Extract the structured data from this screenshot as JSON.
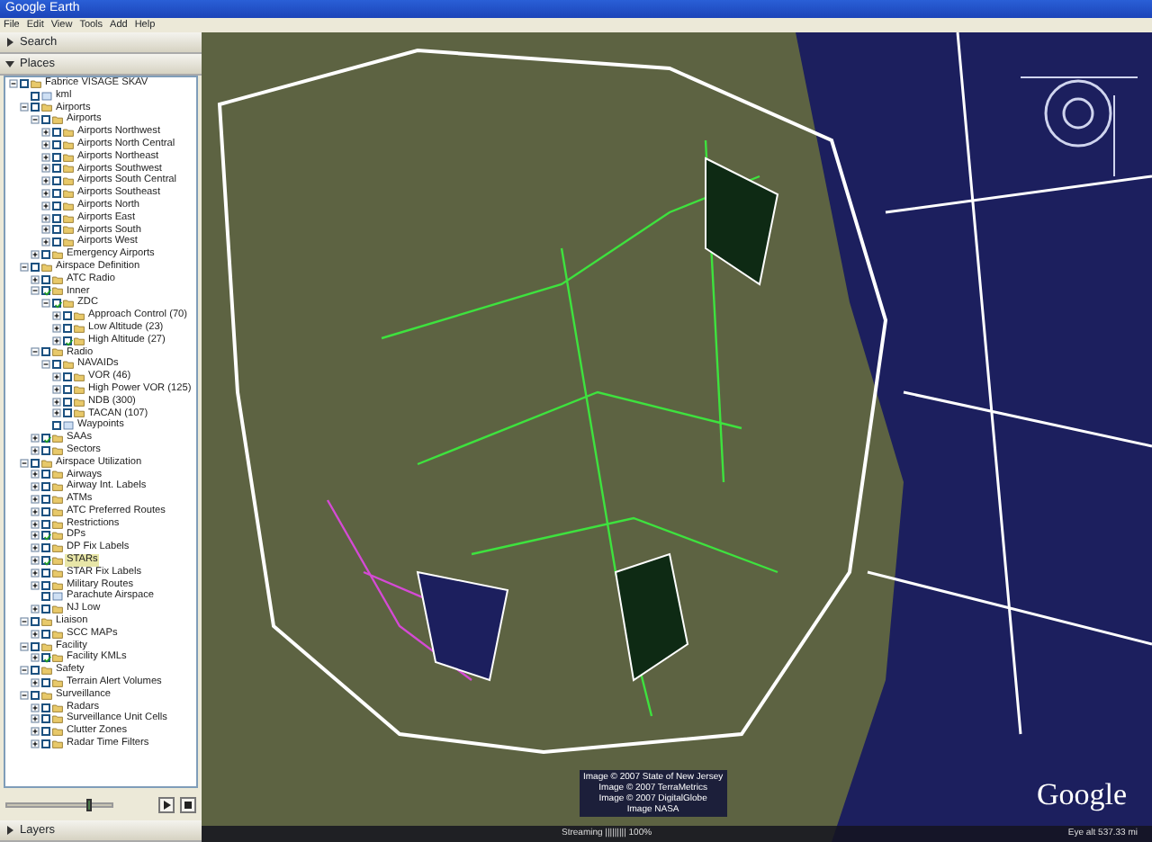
{
  "window": {
    "title": "Google Earth"
  },
  "menu": [
    "File",
    "Edit",
    "View",
    "Tools",
    "Add",
    "Help"
  ],
  "panels": [
    {
      "label": "Search",
      "expanded": false
    },
    {
      "label": "Places",
      "expanded": true
    }
  ],
  "places": [
    {
      "label": "Fabrice VISAGE SKAV",
      "kind": "folder",
      "expanded": true,
      "checked": false,
      "selected": false,
      "children": [
        {
          "label": "kml",
          "kind": "layer",
          "checked": false,
          "selected": false
        },
        {
          "label": "Airports",
          "kind": "folder",
          "expanded": true,
          "checked": false,
          "selected": false,
          "children": [
            {
              "label": "Airports",
              "kind": "folder",
              "expanded": true,
              "checked": false,
              "selected": false,
              "children": [
                {
                  "label": "Airports Northwest",
                  "kind": "folder",
                  "expanded": false,
                  "checked": false,
                  "selected": false
                },
                {
                  "label": "Airports North Central",
                  "kind": "folder",
                  "expanded": false,
                  "checked": false,
                  "selected": false
                },
                {
                  "label": "Airports Northeast",
                  "kind": "folder",
                  "expanded": false,
                  "checked": false,
                  "selected": false
                },
                {
                  "label": "Airports Southwest",
                  "kind": "folder",
                  "expanded": false,
                  "checked": false,
                  "selected": false
                },
                {
                  "label": "Airports South Central",
                  "kind": "folder",
                  "expanded": false,
                  "checked": false,
                  "selected": false
                },
                {
                  "label": "Airports Southeast",
                  "kind": "folder",
                  "expanded": false,
                  "checked": false,
                  "selected": false
                },
                {
                  "label": "Airports North",
                  "kind": "folder",
                  "expanded": false,
                  "checked": false,
                  "selected": false
                },
                {
                  "label": "Airports East",
                  "kind": "folder",
                  "expanded": false,
                  "checked": false,
                  "selected": false
                },
                {
                  "label": "Airports South",
                  "kind": "folder",
                  "expanded": false,
                  "checked": false,
                  "selected": false
                },
                {
                  "label": "Airports West",
                  "kind": "folder",
                  "expanded": false,
                  "checked": false,
                  "selected": false
                }
              ]
            },
            {
              "label": "Emergency Airports",
              "kind": "folder",
              "expanded": false,
              "checked": false,
              "selected": false
            }
          ]
        },
        {
          "label": "Airspace Definition",
          "kind": "folder",
          "expanded": true,
          "checked": false,
          "selected": false,
          "children": [
            {
              "label": "ATC Radio",
              "kind": "folder",
              "expanded": false,
              "checked": false,
              "selected": false
            },
            {
              "label": "Inner",
              "kind": "folder",
              "expanded": true,
              "checked": true,
              "selected": false,
              "children": [
                {
                  "label": "ZDC",
                  "kind": "folder",
                  "expanded": true,
                  "checked": true,
                  "selected": false,
                  "children": [
                    {
                      "label": "Approach Control (70)",
                      "kind": "folder",
                      "expanded": false,
                      "checked": false,
                      "selected": false
                    },
                    {
                      "label": "Low Altitude (23)",
                      "kind": "folder",
                      "expanded": false,
                      "checked": false,
                      "selected": false
                    },
                    {
                      "label": "High Altitude (27)",
                      "kind": "folder",
                      "expanded": false,
                      "checked": true,
                      "selected": false
                    }
                  ]
                }
              ]
            },
            {
              "label": "Radio",
              "kind": "folder",
              "expanded": true,
              "checked": false,
              "selected": false,
              "children": [
                {
                  "label": "NAVAIDs",
                  "kind": "folder",
                  "expanded": true,
                  "checked": false,
                  "selected": false,
                  "children": [
                    {
                      "label": "VOR (46)",
                      "kind": "folder",
                      "expanded": false,
                      "checked": false,
                      "selected": false
                    },
                    {
                      "label": "High Power VOR (125)",
                      "kind": "folder",
                      "expanded": false,
                      "checked": false,
                      "selected": false
                    },
                    {
                      "label": "NDB (300)",
                      "kind": "folder",
                      "expanded": false,
                      "checked": false,
                      "selected": false
                    },
                    {
                      "label": "TACAN (107)",
                      "kind": "folder",
                      "expanded": false,
                      "checked": false,
                      "selected": false
                    }
                  ]
                },
                {
                  "label": "Waypoints",
                  "kind": "layer",
                  "checked": false,
                  "selected": false
                }
              ]
            },
            {
              "label": "SAAs",
              "kind": "folder",
              "expanded": false,
              "checked": true,
              "selected": false
            },
            {
              "label": "Sectors",
              "kind": "folder",
              "expanded": false,
              "checked": false,
              "selected": false
            }
          ]
        },
        {
          "label": "Airspace Utilization",
          "kind": "folder",
          "expanded": true,
          "checked": false,
          "selected": false,
          "children": [
            {
              "label": "Airways",
              "kind": "folder",
              "expanded": false,
              "checked": false,
              "selected": false
            },
            {
              "label": "Airway Int. Labels",
              "kind": "folder",
              "expanded": false,
              "checked": false,
              "selected": false
            },
            {
              "label": "ATMs",
              "kind": "folder",
              "expanded": false,
              "checked": false,
              "selected": false
            },
            {
              "label": "ATC Preferred Routes",
              "kind": "folder",
              "expanded": false,
              "checked": false,
              "selected": false
            },
            {
              "label": "Restrictions",
              "kind": "folder",
              "expanded": false,
              "checked": false,
              "selected": false
            },
            {
              "label": "DPs",
              "kind": "folder",
              "expanded": false,
              "checked": true,
              "selected": false
            },
            {
              "label": "DP Fix Labels",
              "kind": "folder",
              "expanded": false,
              "checked": false,
              "selected": false
            },
            {
              "label": "STARs",
              "kind": "folder",
              "expanded": false,
              "checked": true,
              "selected": true
            },
            {
              "label": "STAR Fix Labels",
              "kind": "folder",
              "expanded": false,
              "checked": false,
              "selected": false
            },
            {
              "label": "Military Routes",
              "kind": "folder",
              "expanded": false,
              "checked": false,
              "selected": false
            },
            {
              "label": "Parachute Airspace",
              "kind": "layer",
              "checked": false,
              "selected": false
            },
            {
              "label": "NJ Low",
              "kind": "folder",
              "expanded": false,
              "checked": false,
              "selected": false
            }
          ]
        },
        {
          "label": "Liaison",
          "kind": "folder",
          "expanded": true,
          "checked": false,
          "selected": false,
          "children": [
            {
              "label": "SCC MAPs",
              "kind": "folder",
              "expanded": false,
              "checked": false,
              "selected": false
            }
          ]
        },
        {
          "label": "Facility",
          "kind": "folder",
          "expanded": true,
          "checked": false,
          "selected": false,
          "children": [
            {
              "label": "Facility KMLs",
              "kind": "folder",
              "expanded": false,
              "checked": true,
              "selected": false
            }
          ]
        },
        {
          "label": "Safety",
          "kind": "folder",
          "expanded": true,
          "checked": false,
          "selected": false,
          "children": [
            {
              "label": "Terrain Alert Volumes",
              "kind": "folder",
              "expanded": false,
              "checked": false,
              "selected": false
            }
          ]
        },
        {
          "label": "Surveillance",
          "kind": "folder",
          "expanded": true,
          "checked": false,
          "selected": false,
          "children": [
            {
              "label": "Radars",
              "kind": "folder",
              "expanded": false,
              "checked": false,
              "selected": false
            },
            {
              "label": "Surveillance Unit Cells",
              "kind": "folder",
              "expanded": false,
              "checked": false,
              "selected": false
            },
            {
              "label": "Clutter Zones",
              "kind": "folder",
              "expanded": false,
              "checked": false,
              "selected": false
            },
            {
              "label": "Radar Time Filters",
              "kind": "folder",
              "expanded": false,
              "checked": false,
              "selected": false
            }
          ]
        }
      ]
    }
  ],
  "opacity_slider": {
    "level": 0.8
  },
  "layers_panel": {
    "label": "Layers",
    "expanded": false
  },
  "map": {
    "attribution": [
      "Image © 2007 State of New Jersey",
      "Image © 2007 TerraMetrics",
      "Image © 2007 DigitalGlobe",
      "Image NASA"
    ],
    "logo": "Google",
    "streaming": "Streaming ||||||||| 100%",
    "eye_alt": "Eye alt  537.33 mi"
  }
}
